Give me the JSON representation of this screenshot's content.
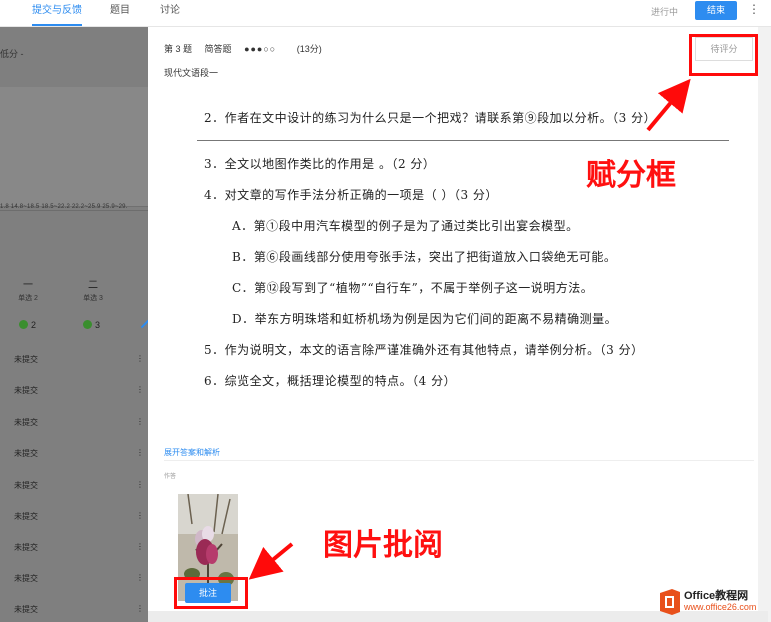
{
  "topbar": {
    "tabs": [
      {
        "label": "提交与反馈",
        "active": true
      },
      {
        "label": "题目",
        "active": false
      },
      {
        "label": "讨论",
        "active": false
      }
    ],
    "status": "进行中",
    "end_button": "结束",
    "more_icon": "⋮"
  },
  "left_panel": {
    "filter_label": "低分 -",
    "tick_labels": "1.8  14.8~18.5  18.5~22.2  22.2~25.9  25.9~29.",
    "questions": [
      {
        "num": "一",
        "type": "单选 2",
        "count": "2"
      },
      {
        "num": "二",
        "type": "单选 3",
        "count": "3"
      }
    ],
    "row_label": "未提交",
    "row_more": "⋮"
  },
  "question": {
    "number": "第 3 题",
    "type": "简答题",
    "stars": "●●●○○",
    "score": "(13分)",
    "section": "现代文语段一",
    "grade_placeholder": "待评分",
    "lines": [
      "2．作者在文中设计的练习为什么只是一个把戏？请联系第⑨段加以分析。（3 分）",
      "3．全文以地图作类比的作用是   。（2 分）",
      "4．对文章的写作手法分析正确的一项是（  ）（3 分）",
      "A．第①段中用汽车模型的例子是为了通过类比引出宴会模型。",
      "B．第⑥段画线部分使用夸张手法，突出了把街道放入口袋绝无可能。",
      "C．第⑫段写到了“植物”“自行车”，不属于举例子这一说明方法。",
      "D．举东方明珠塔和虹桥机场为例是因为它们间的距离不易精确测量。",
      "5．作为说明文，本文的语言除严谨准确外还有其他特点，请举例分析。（3 分）",
      "6．综览全文，概括理论模型的特点。（4 分）"
    ],
    "expand_label": "展开答案和解析",
    "works_label": "作答",
    "annotate_button": "批注"
  },
  "annotations": {
    "score_box_caption": "赋分框",
    "image_review_caption": "图片批阅",
    "color": "#ff0a0a"
  },
  "watermark": {
    "title": "Office教程网",
    "url": "www.office26.com"
  }
}
